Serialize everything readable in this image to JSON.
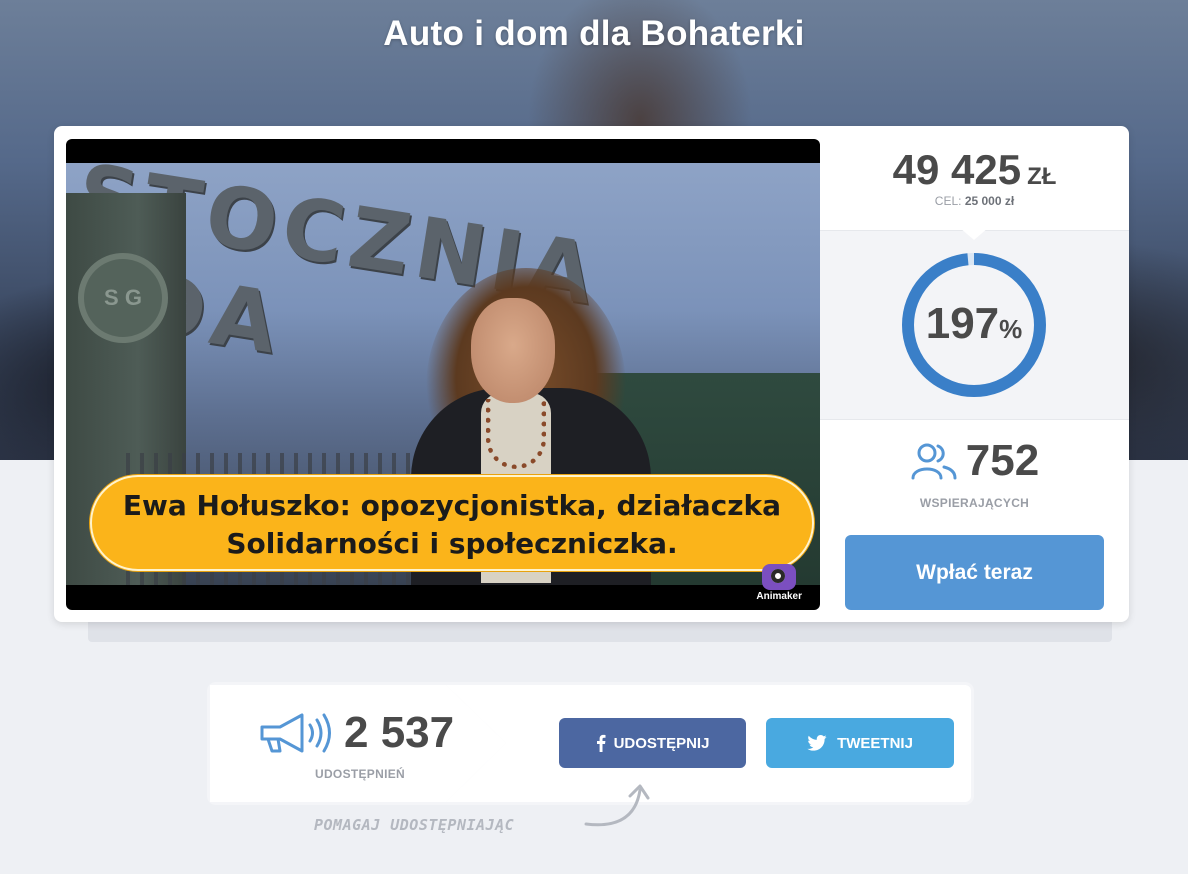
{
  "page": {
    "title": "Auto i dom dla Bohaterki"
  },
  "video": {
    "sign_text": "STOCZNIA GDA",
    "logo_text": "S G",
    "caption_line1": "Ewa Hołuszko: opozycjonistka, działaczka",
    "caption_line2": "Solidarności i społeczniczka.",
    "watermark": "Animaker"
  },
  "stats": {
    "amount": "49 425",
    "currency": "ZŁ",
    "goal_label": "CEL:",
    "goal_value": "25 000 zł",
    "percent_value": "197",
    "percent_sign": "%",
    "percent_fraction": 1.97,
    "supporters_count": "752",
    "supporters_label": "WSPIERAJĄCYCH",
    "pay_button": "Wpłać teraz"
  },
  "share": {
    "count": "2 537",
    "label": "UDOSTĘPNIEŃ",
    "facebook_button": "UDOSTĘPNIJ",
    "twitter_button": "TWEETNIJ",
    "hint": "POMAGAJ UDOSTĘPNIAJĄC"
  },
  "icons": {
    "supporters": "people-icon",
    "share": "megaphone-icon",
    "facebook": "facebook-icon",
    "twitter": "twitter-icon",
    "hint_arrow": "curved-arrow-icon"
  },
  "colors": {
    "accent": "#5596d5",
    "ring": "#3a7fc8",
    "facebook": "#4c67a1",
    "twitter": "#49a9e0",
    "caption_banner": "#fbb41a"
  }
}
